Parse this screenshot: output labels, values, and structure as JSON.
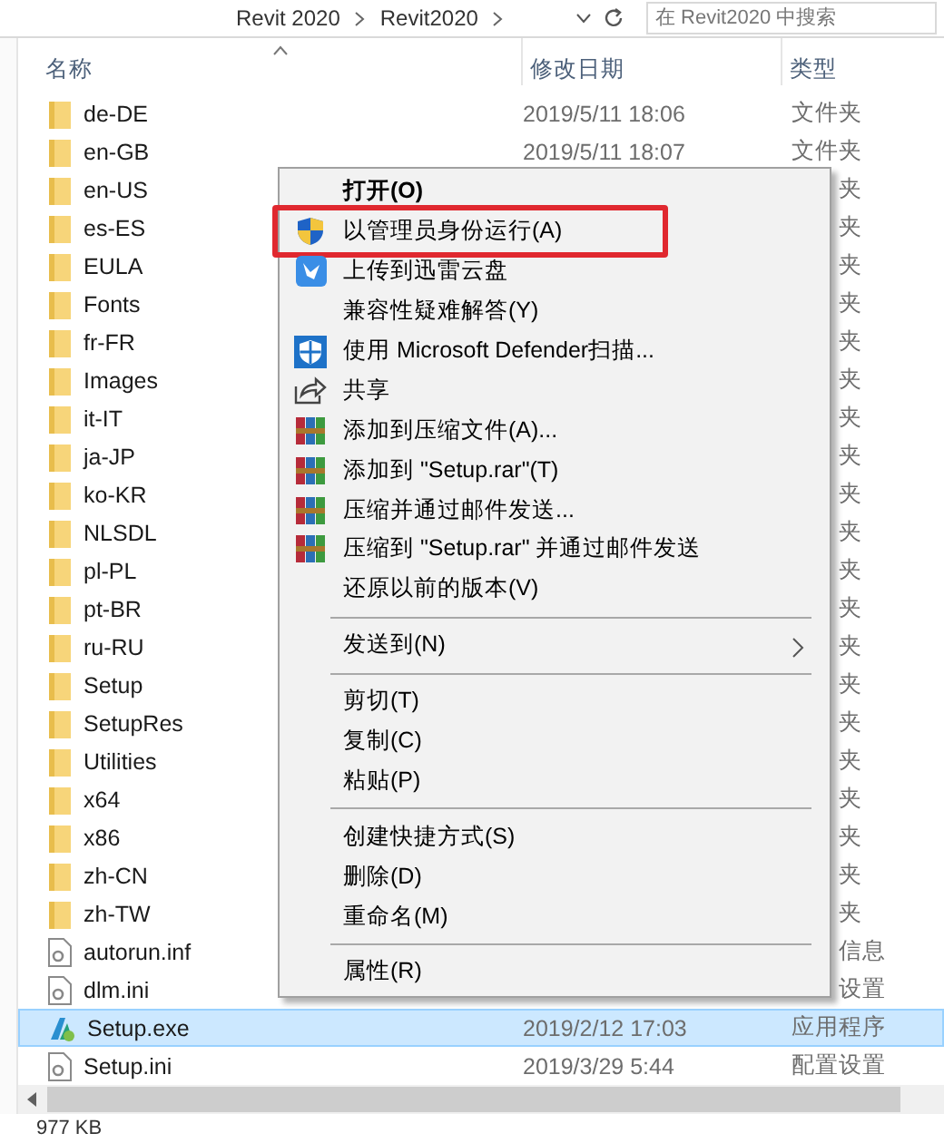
{
  "address_bar": {
    "crumbs": [
      "Revit 2020",
      "Revit2020"
    ],
    "search_placeholder": "在 Revit2020 中搜索"
  },
  "columns": [
    "名称",
    "修改日期",
    "类型"
  ],
  "rows": [
    {
      "name": "de-DE",
      "kind": "folder",
      "date": "2019/5/11 18:06",
      "type": "文件夹",
      "selected": false
    },
    {
      "name": "en-GB",
      "kind": "folder",
      "date": "2019/5/11 18:07",
      "type": "文件夹",
      "selected": false
    },
    {
      "name": "en-US",
      "kind": "folder",
      "type": "夹",
      "selected": false
    },
    {
      "name": "es-ES",
      "kind": "folder",
      "type": "夹",
      "selected": false
    },
    {
      "name": "EULA",
      "kind": "folder",
      "type": "夹",
      "selected": false
    },
    {
      "name": "Fonts",
      "kind": "folder",
      "type": "夹",
      "selected": false
    },
    {
      "name": "fr-FR",
      "kind": "folder",
      "type": "夹",
      "selected": false
    },
    {
      "name": "Images",
      "kind": "folder",
      "type": "夹",
      "selected": false
    },
    {
      "name": "it-IT",
      "kind": "folder",
      "type": "夹",
      "selected": false
    },
    {
      "name": "ja-JP",
      "kind": "folder",
      "type": "夹",
      "selected": false
    },
    {
      "name": "ko-KR",
      "kind": "folder",
      "type": "夹",
      "selected": false
    },
    {
      "name": "NLSDL",
      "kind": "folder",
      "type": "夹",
      "selected": false
    },
    {
      "name": "pl-PL",
      "kind": "folder",
      "type": "夹",
      "selected": false
    },
    {
      "name": "pt-BR",
      "kind": "folder",
      "type": "夹",
      "selected": false
    },
    {
      "name": "ru-RU",
      "kind": "folder",
      "type": "夹",
      "selected": false
    },
    {
      "name": "Setup",
      "kind": "folder",
      "type": "夹",
      "selected": false
    },
    {
      "name": "SetupRes",
      "kind": "folder",
      "type": "夹",
      "selected": false
    },
    {
      "name": "Utilities",
      "kind": "folder",
      "type": "夹",
      "selected": false
    },
    {
      "name": "x64",
      "kind": "folder",
      "type": "夹",
      "selected": false
    },
    {
      "name": "x86",
      "kind": "folder",
      "type": "夹",
      "selected": false
    },
    {
      "name": "zh-CN",
      "kind": "folder",
      "type": "夹",
      "selected": false
    },
    {
      "name": "zh-TW",
      "kind": "folder",
      "type": "夹",
      "selected": false
    },
    {
      "name": "autorun.inf",
      "kind": "config",
      "type": "信息",
      "selected": false
    },
    {
      "name": "dlm.ini",
      "kind": "config",
      "type": "设置",
      "selected": false
    },
    {
      "name": "Setup.exe",
      "kind": "app",
      "date": "2019/2/12 17:03",
      "type": "应用程序",
      "selected": true
    },
    {
      "name": "Setup.ini",
      "kind": "config",
      "date": "2019/3/29 5:44",
      "type": "配置设置",
      "selected": false
    }
  ],
  "context_menu": [
    {
      "kind": "plain",
      "label": "打开(O)",
      "bold": true,
      "annotated": false
    },
    {
      "kind": "shield",
      "label": "以管理员身份运行(A)",
      "bold": false,
      "annotated": true
    },
    {
      "kind": "cloud",
      "label": "上传到迅雷云盘",
      "bold": false,
      "annotated": false
    },
    {
      "kind": "plain",
      "label": "兼容性疑难解答(Y)",
      "bold": false,
      "annotated": false
    },
    {
      "kind": "defender",
      "label": "使用 Microsoft Defender扫描...",
      "bold": false,
      "annotated": false
    },
    {
      "kind": "share",
      "label": "共享",
      "bold": false,
      "annotated": false
    },
    {
      "kind": "archive",
      "label": "添加到压缩文件(A)...",
      "bold": false,
      "annotated": false
    },
    {
      "kind": "archive",
      "label": "添加到 \"Setup.rar\"(T)",
      "bold": false,
      "annotated": false
    },
    {
      "kind": "archive",
      "label": "压缩并通过邮件发送...",
      "bold": false,
      "annotated": false
    },
    {
      "kind": "archive",
      "label": "压缩到 \"Setup.rar\" 并通过邮件发送",
      "bold": false,
      "annotated": false
    },
    {
      "kind": "plain",
      "label": "还原以前的版本(V)",
      "bold": false,
      "annotated": false
    },
    {
      "kind": "separator"
    },
    {
      "kind": "submenu",
      "label": "发送到(N)",
      "bold": false,
      "annotated": false
    },
    {
      "kind": "separator"
    },
    {
      "kind": "plain",
      "label": "剪切(T)",
      "bold": false,
      "annotated": false
    },
    {
      "kind": "plain",
      "label": "复制(C)",
      "bold": false,
      "annotated": false
    },
    {
      "kind": "plain",
      "label": "粘贴(P)",
      "bold": false,
      "annotated": false
    },
    {
      "kind": "separator"
    },
    {
      "kind": "plain",
      "label": "创建快捷方式(S)",
      "bold": false,
      "annotated": false
    },
    {
      "kind": "plain",
      "label": "删除(D)",
      "bold": false,
      "annotated": false
    },
    {
      "kind": "plain",
      "label": "重命名(M)",
      "bold": false,
      "annotated": false
    },
    {
      "kind": "separator"
    },
    {
      "kind": "plain",
      "label": "属性(R)",
      "bold": false,
      "annotated": false
    }
  ],
  "status_bar": {
    "size": "977 KB"
  }
}
